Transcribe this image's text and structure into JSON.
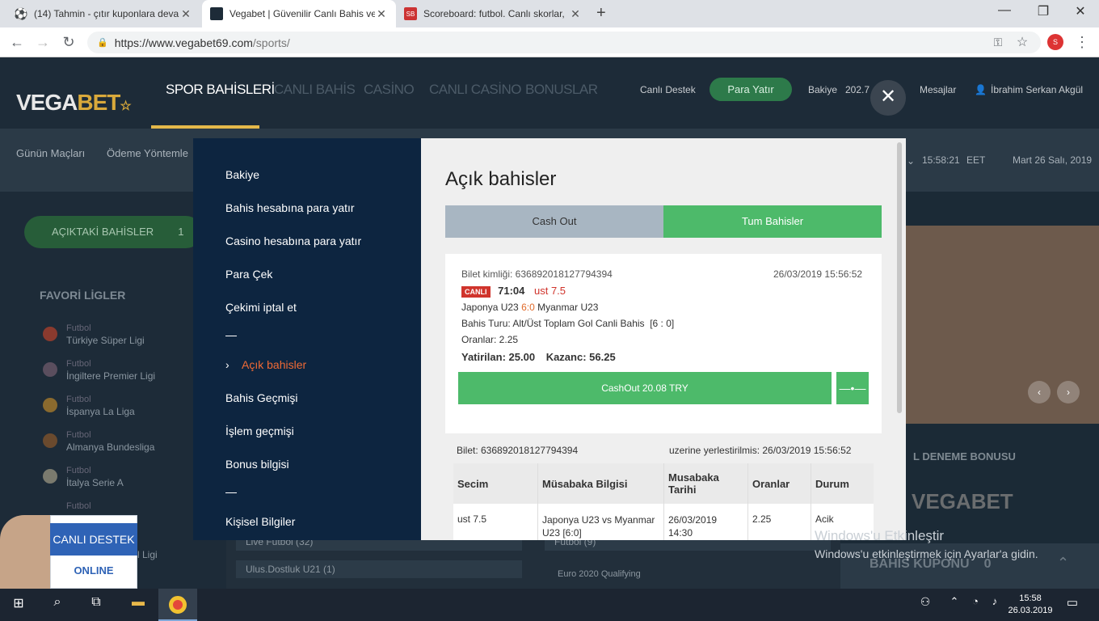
{
  "browser": {
    "tabs": [
      {
        "title": "(14) Tahmin - çıtır kuponlara deva",
        "active": false
      },
      {
        "title": "Vegabet | Güvenilir Canlı Bahis ve",
        "active": true
      },
      {
        "title": "Scoreboard: futbol. Canlı skorlar,",
        "active": false
      }
    ],
    "url_domain": "https://www.vegabet69.com",
    "url_path": "/sports/",
    "profile_initial": "S"
  },
  "site": {
    "logo_a": "VEGA",
    "logo_b": "BET",
    "nav": [
      "SPOR BAHİSLERİ",
      "CANLI BAHİS",
      "CASİNO",
      "CANLI CASİNO",
      "BONUSLAR"
    ],
    "support": "Canlı Destek",
    "deposit": "Para Yatır",
    "balance_label": "Bakiye",
    "balance_value": "202.7",
    "messages": "Mesajlar",
    "user": "İbrahim Serkan Akgül",
    "subnav": [
      "Günün Maçları",
      "Ödeme Yöntemle"
    ],
    "time": "15:58:21",
    "tz": "EET",
    "date": "Mart 26 Salı, 2019",
    "open_bets_btn": "AÇIKTAKİ BAHİSLER",
    "open_bets_count": "1",
    "favorites_title": "FAVORİ LİGLER",
    "leagues": [
      {
        "sport": "Futbol",
        "name": "Türkiye Süper Ligi"
      },
      {
        "sport": "Futbol",
        "name": "İngiltere Premier Ligi"
      },
      {
        "sport": "Futbol",
        "name": "İspanya La Liga"
      },
      {
        "sport": "Futbol",
        "name": "Almanya Bundesliga"
      },
      {
        "sport": "Futbol",
        "name": "İtalya Serie A"
      },
      {
        "sport": "Futbol",
        "name": ""
      }
    ],
    "league_partial": "l Ligi",
    "right_title": "L DENEME BONUSU",
    "bottom_rows": [
      "Live Futbol (32)",
      "Ulus.Dostluk U21 (1)",
      "Futbol (9)",
      "Euro 2020 Qualifying"
    ],
    "bet_slip": "BAHİS KUPONU",
    "bet_slip_count": "0"
  },
  "modal": {
    "menu": [
      "Bakiye",
      "Bahis hesabına para yatır",
      "Casino hesabına para yatır",
      "Para Çek",
      "Çekimi iptal et",
      "Açık bahisler",
      "Bahis Geçmişi",
      "İşlem geçmişi",
      "Bonus bilgisi",
      "Kişisel Bilgiler"
    ],
    "title": "Açık bahisler",
    "tab_cashout": "Cash Out",
    "tab_all": "Tum Bahisler",
    "card": {
      "ticket_id": "Bilet kimliği: 636892018127794394",
      "datetime": "26/03/2019 15:56:52",
      "live_badge": "CANLI",
      "minute": "71:04",
      "pick": "ust 7.5",
      "team_a": "Japonya U23",
      "score": "6:0",
      "team_b": "Myanmar U23",
      "bet_type": "Bahis Turu: Alt/Üst Toplam Gol Canli Bahis  [6 : 0]",
      "odds": "Oranlar: 2.25",
      "stake": "Yatirilan: 25.00",
      "win": "Kazanc: 56.25",
      "cashout_btn": "CashOut 20.08 TRY",
      "slider_icon": "—•—"
    },
    "ticket": {
      "id": "Bilet: 636892018127794394",
      "placed": "uzerine yerlestirilmis: 26/03/2019 15:56:52",
      "headers": [
        "Secim",
        "Müsabaka Bilgisi",
        "Musabaka Tarihi",
        "Oranlar",
        "Durum"
      ],
      "row": [
        "ust 7.5",
        "Japonya U23 vs Myanmar U23 [6:0]",
        "26/03/2019 14:30",
        "2.25",
        "Acik"
      ]
    }
  },
  "chat": {
    "label": "CANLI DESTEK",
    "status": "ONLINE"
  },
  "watermark": {
    "line1": "Windows'u Etkinleştir",
    "line2": "Windows'u etkinleştirmek için Ayarlar'a gidin."
  },
  "taskbar": {
    "time": "15:58",
    "date": "26.03.2019"
  }
}
